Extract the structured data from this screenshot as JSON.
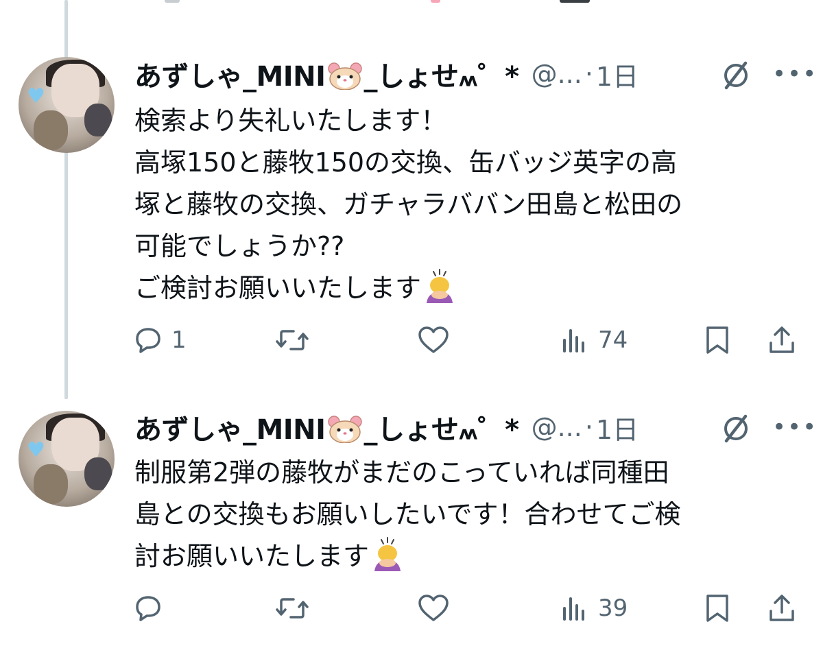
{
  "tweets": [
    {
      "author": {
        "name_prefix": "あずしゃ_MINI",
        "name_emoji": "hamster-face",
        "name_suffix": "_しょせ៳゜*",
        "handle": "@...",
        "separator": "·",
        "time": "1日"
      },
      "text_lines": [
        "検索より失礼いたします！",
        "高塚150と藤牧150の交換、缶バッジ英字の高",
        "塚と藤牧の交換、ガチャラババン田島と松田の",
        "可能でしょうか??",
        "ご検討お願いいたします"
      ],
      "trailing_emoji": "person-bowing",
      "actions": {
        "reply": "1",
        "retweet": "",
        "like": "",
        "views": "74",
        "bookmark_icon": "bookmark-icon",
        "share_icon": "share-icon"
      }
    },
    {
      "author": {
        "name_prefix": "あずしゃ_MINI",
        "name_emoji": "hamster-face",
        "name_suffix": "_しょせ៳゜*",
        "handle": "@...",
        "separator": "·",
        "time": "1日"
      },
      "text_lines": [
        "制服第2弾の藤牧がまだのこっていれば同種田",
        "島との交換もお願いしたいです！合わせてご検",
        "討お願いいたします"
      ],
      "trailing_emoji": "person-bowing",
      "actions": {
        "reply": "",
        "retweet": "",
        "like": "",
        "views": "39",
        "bookmark_icon": "bookmark-icon",
        "share_icon": "share-icon"
      }
    }
  ],
  "colors": {
    "text": "#0f1419",
    "secondary": "#536471",
    "thread_line": "#cfd9de",
    "avatar_heart": "#7ec8f0"
  }
}
